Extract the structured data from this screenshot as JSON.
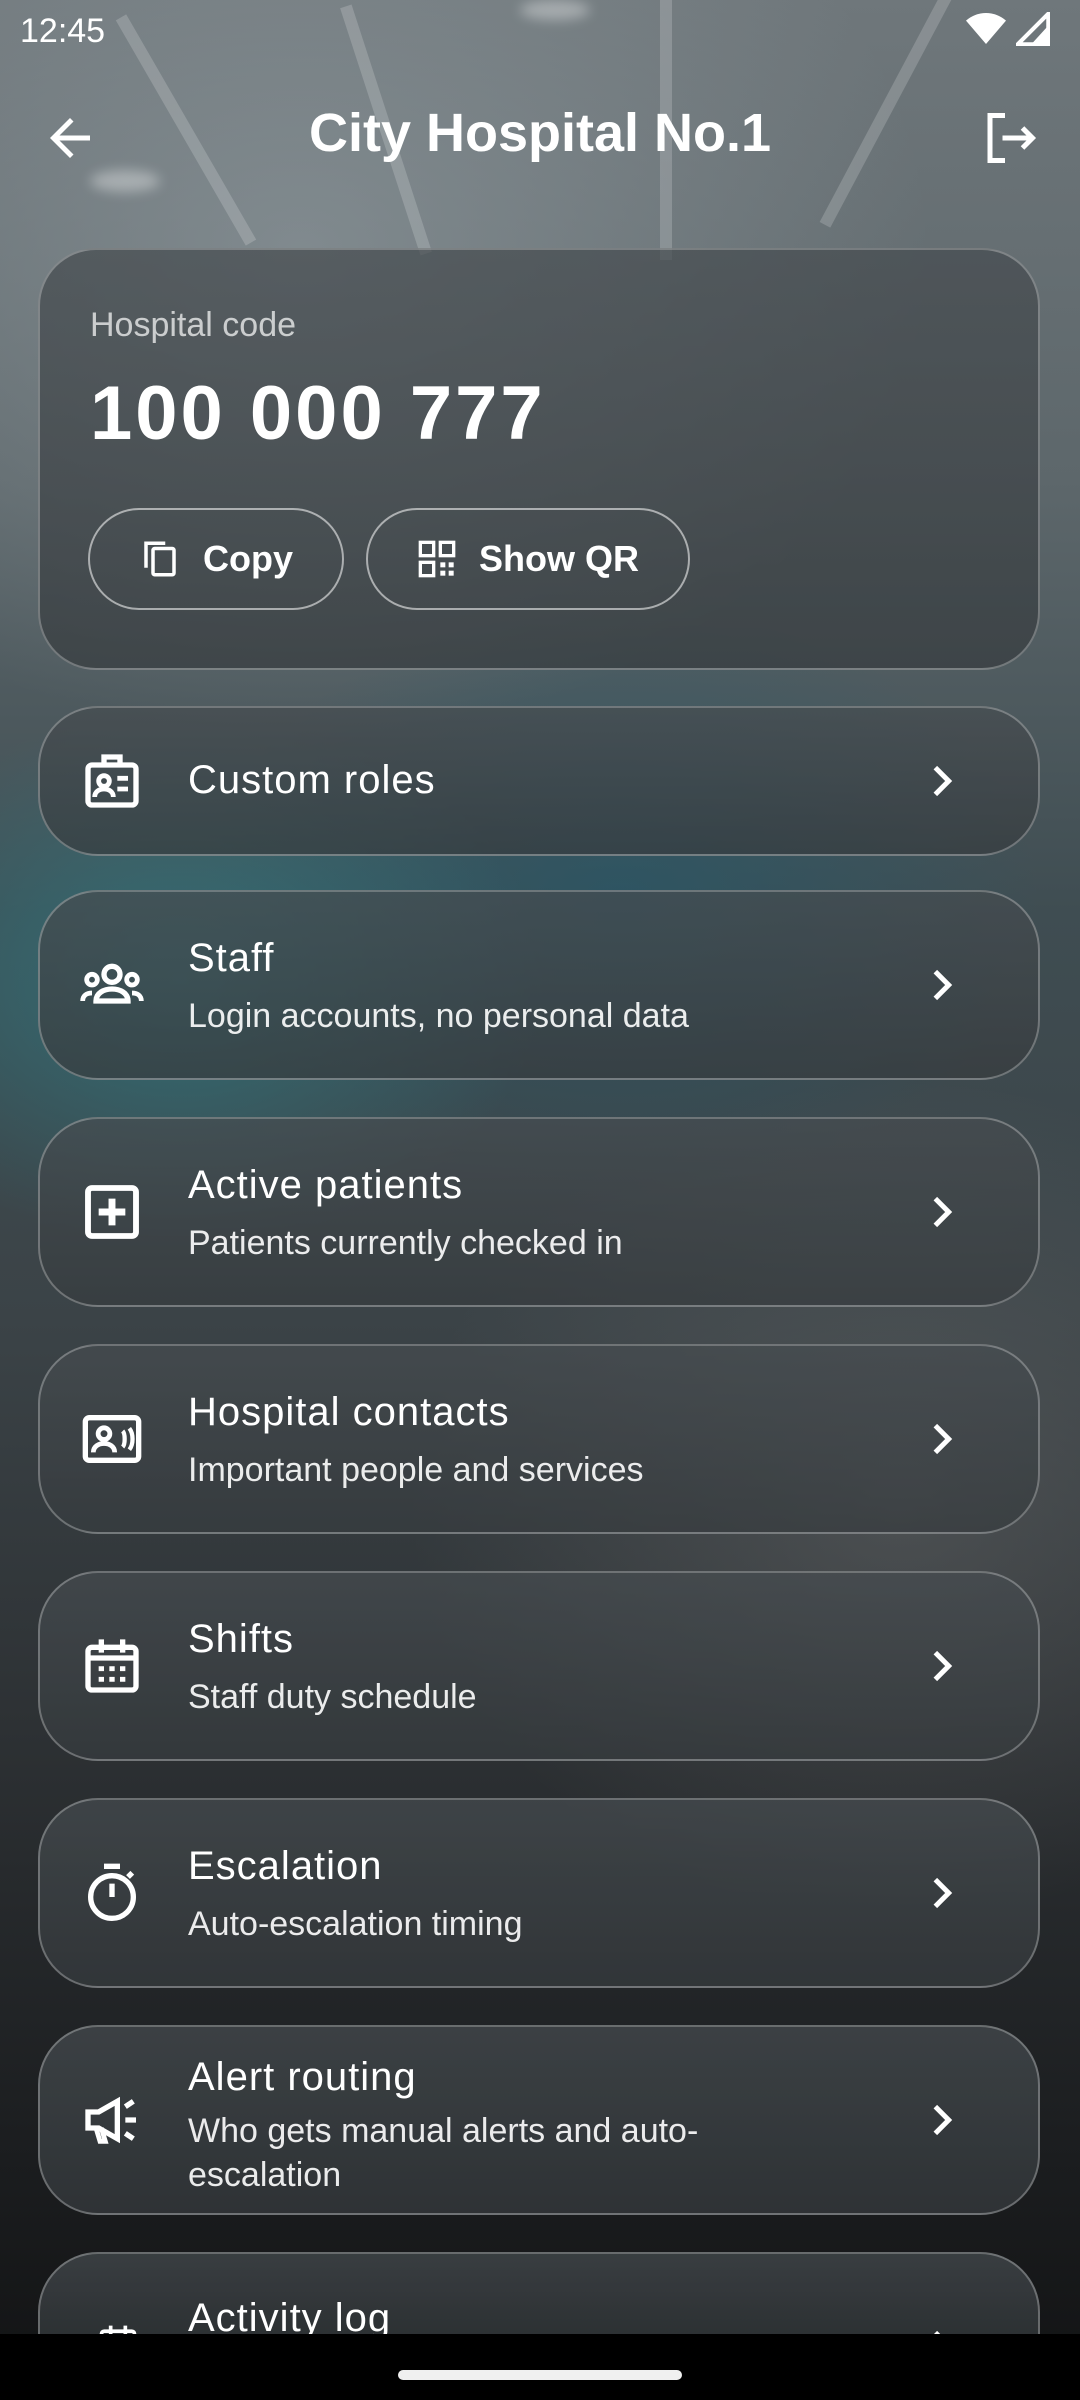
{
  "status_bar": {
    "time": "12:45",
    "wifi_icon": "wifi-icon",
    "signal_icon": "cell-signal-icon"
  },
  "app_bar": {
    "title": "City Hospital No.1",
    "back_icon": "arrow-back-icon",
    "logout_icon": "logout-icon"
  },
  "hospital_code": {
    "label": "Hospital code",
    "value": "100 000 777",
    "copy_label": "Copy",
    "qr_label": "Show QR",
    "copy_icon": "copy-icon",
    "qr_icon": "qr-code-icon"
  },
  "menu": {
    "custom_roles": {
      "title": "Custom roles",
      "icon": "badge-icon"
    },
    "staff": {
      "title": "Staff",
      "subtitle": "Login accounts, no personal data",
      "icon": "group-icon"
    },
    "active_patients": {
      "title": "Active patients",
      "subtitle": "Patients currently checked in",
      "icon": "medical-plus-icon"
    },
    "contacts": {
      "title": "Hospital contacts",
      "subtitle": "Important people and services",
      "icon": "contact-card-icon"
    },
    "shifts": {
      "title": "Shifts",
      "subtitle": "Staff duty schedule",
      "icon": "calendar-icon"
    },
    "escalation": {
      "title": "Escalation",
      "subtitle": "Auto-escalation timing",
      "icon": "timer-icon"
    },
    "alert_routing": {
      "title": "Alert routing",
      "subtitle": "Who gets manual alerts and auto-escalation",
      "icon": "campaign-icon"
    },
    "activity_log": {
      "title": "Activity log",
      "icon": "event-note-icon"
    }
  },
  "colors": {
    "text": "#ffffff",
    "card_border": "rgba(255,255,255,0.28)"
  }
}
